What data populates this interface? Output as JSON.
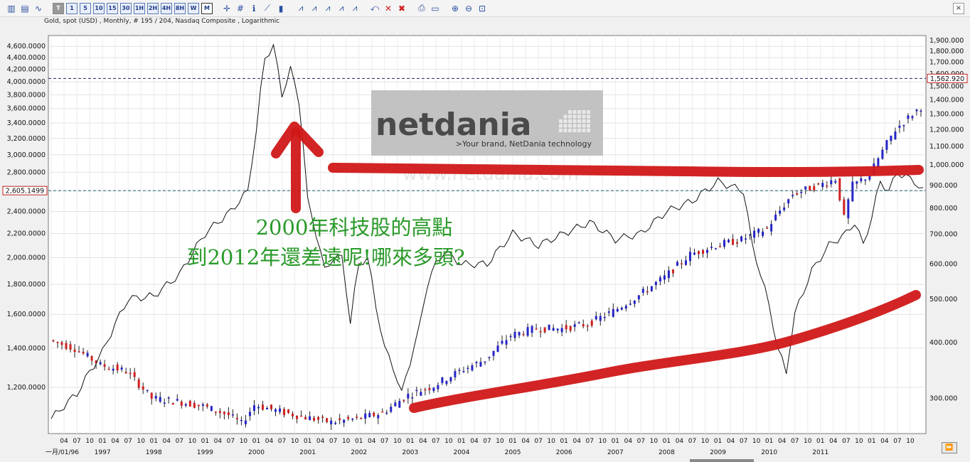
{
  "toolbar": {
    "periods": [
      "T",
      "1",
      "5",
      "10",
      "15",
      "30",
      "1H",
      "2H",
      "4H",
      "8H",
      "W",
      "M"
    ],
    "active_period": "M"
  },
  "subtitle": "Gold, spot (USD) , Monthly, # 195 / 204, Nasdaq Composite , Logarithmic",
  "close_label": "×",
  "scroll_label": "⏩",
  "colors": {
    "up": "#2424c8",
    "down": "#d02020",
    "marker": "#d01818",
    "line": "#111111"
  },
  "chart_data": {
    "type": "candlestick+line",
    "left_axis": {
      "label": "Nasdaq Composite",
      "scale": "log",
      "range": [
        1000,
        4800
      ],
      "ticks": [
        "1,200.0000",
        "1,400.0000",
        "1,600.0000",
        "1,800.0000",
        "2,000.0000",
        "2,200.0000",
        "2,400.0000",
        "2,600.0000",
        "2,800.0000",
        "3,000.0000",
        "3,200.0000",
        "3,400.0000",
        "3,600.0000",
        "3,800.0000",
        "4,000.0000",
        "4,200.0000",
        "4,400.0000",
        "4,600.0000"
      ],
      "cursor_value": "2,605.1499"
    },
    "right_axis": {
      "label": "Gold, spot (USD)",
      "scale": "log",
      "range": [
        250,
        1950
      ],
      "ticks": [
        "300.000",
        "400.000",
        "500.000",
        "600.000",
        "700.000",
        "800.000",
        "900.000",
        "1,000.000",
        "1,100.000",
        "1,200.000",
        "1,300.000",
        "1,400.000",
        "1,500.000",
        "1,600.000",
        "1,700.000",
        "1,800.000",
        "1,900.000"
      ],
      "last_value": "1,562.920"
    },
    "x_axis": {
      "start": "1996-01",
      "months": 204,
      "month_labels": [
        "01",
        "04",
        "07",
        "10"
      ],
      "first_label": "一月/01/96",
      "years": [
        "1997",
        "1998",
        "1999",
        "2000",
        "2001",
        "2002",
        "2003",
        "2004",
        "2005",
        "2006",
        "2007",
        "2008",
        "2009",
        "2010",
        "2011"
      ]
    },
    "gold_anchors": [
      [
        0,
        405
      ],
      [
        6,
        388
      ],
      [
        12,
        356
      ],
      [
        18,
        345
      ],
      [
        24,
        300
      ],
      [
        30,
        295
      ],
      [
        36,
        288
      ],
      [
        42,
        275
      ],
      [
        45,
        263
      ],
      [
        48,
        290
      ],
      [
        54,
        280
      ],
      [
        60,
        272
      ],
      [
        66,
        265
      ],
      [
        72,
        270
      ],
      [
        78,
        278
      ],
      [
        84,
        305
      ],
      [
        90,
        320
      ],
      [
        96,
        345
      ],
      [
        102,
        366
      ],
      [
        108,
        415
      ],
      [
        114,
        430
      ],
      [
        120,
        430
      ],
      [
        126,
        440
      ],
      [
        132,
        470
      ],
      [
        138,
        510
      ],
      [
        144,
        560
      ],
      [
        150,
        630
      ],
      [
        156,
        660
      ],
      [
        162,
        680
      ],
      [
        168,
        720
      ],
      [
        174,
        860
      ],
      [
        180,
        900
      ],
      [
        184,
        930
      ],
      [
        186,
        760
      ],
      [
        188,
        900
      ],
      [
        192,
        950
      ],
      [
        198,
        1200
      ],
      [
        204,
        1350
      ],
      [
        210,
        1450
      ],
      [
        216,
        1560
      ]
    ],
    "nasdaq_anchors": [
      [
        0,
        1060
      ],
      [
        6,
        1170
      ],
      [
        12,
        1380
      ],
      [
        18,
        1700
      ],
      [
        24,
        1720
      ],
      [
        30,
        1870
      ],
      [
        36,
        2200
      ],
      [
        42,
        2400
      ],
      [
        46,
        2600
      ],
      [
        48,
        3300
      ],
      [
        50,
        4400
      ],
      [
        52,
        4600
      ],
      [
        54,
        3800
      ],
      [
        56,
        4200
      ],
      [
        58,
        3700
      ],
      [
        60,
        2500
      ],
      [
        62,
        2200
      ],
      [
        64,
        1900
      ],
      [
        66,
        2000
      ],
      [
        68,
        2000
      ],
      [
        70,
        1550
      ],
      [
        72,
        1950
      ],
      [
        74,
        2000
      ],
      [
        76,
        1650
      ],
      [
        78,
        1400
      ],
      [
        80,
        1300
      ],
      [
        82,
        1170
      ],
      [
        84,
        1330
      ],
      [
        86,
        1500
      ],
      [
        88,
        1800
      ],
      [
        90,
        1950
      ],
      [
        92,
        2050
      ],
      [
        96,
        1950
      ],
      [
        102,
        1950
      ],
      [
        108,
        2200
      ],
      [
        114,
        2100
      ],
      [
        120,
        2200
      ],
      [
        126,
        2300
      ],
      [
        132,
        2150
      ],
      [
        138,
        2200
      ],
      [
        144,
        2400
      ],
      [
        150,
        2500
      ],
      [
        156,
        2700
      ],
      [
        162,
        2600
      ],
      [
        164,
        2100
      ],
      [
        168,
        1650
      ],
      [
        170,
        1400
      ],
      [
        172,
        1270
      ],
      [
        174,
        1600
      ],
      [
        178,
        1900
      ],
      [
        182,
        2100
      ],
      [
        186,
        2200
      ],
      [
        188,
        2300
      ],
      [
        190,
        2100
      ],
      [
        192,
        2350
      ],
      [
        194,
        2700
      ],
      [
        196,
        2600
      ],
      [
        198,
        2800
      ],
      [
        202,
        2700
      ],
      [
        204,
        2600
      ],
      [
        206,
        2400
      ],
      [
        208,
        2700
      ],
      [
        212,
        2800
      ],
      [
        214,
        2600
      ],
      [
        216,
        2760
      ]
    ],
    "annotations": {
      "line1": "2000年科技股的高點",
      "line2": "到2012年還差遠呢!哪來多頭?"
    },
    "logo": {
      "name": "netdania",
      "tagline": ">Your brand, NetDania technology",
      "watermark": "www.netdania.com"
    }
  }
}
